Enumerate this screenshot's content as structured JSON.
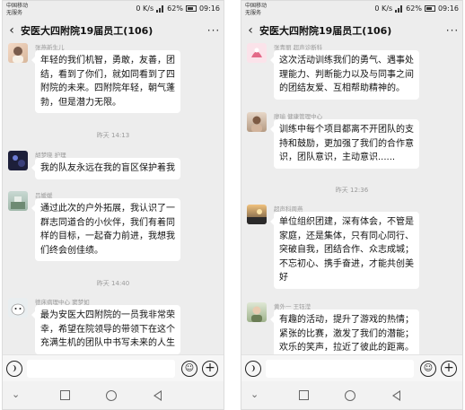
{
  "left": {
    "status": {
      "carrier_line1": "中国移动",
      "carrier_line2": "无服务",
      "speed": "0 K/s",
      "battery": "62%",
      "time": "09:16"
    },
    "header": {
      "title": "安医大四附院19届员工(106)",
      "more": "···"
    },
    "messages": [
      {
        "sender": "张燕新生儿",
        "lines": [
          "年轻的我们机智，勇敢，友善，团",
          "结，看到了你们，就如同看到了四",
          "附院的未来。四附院年轻，朝气蓬",
          "勃，但是潜力无限。"
        ]
      },
      {
        "sender": "胡梦晓 护理",
        "lines": [
          "我的队友永远在我的盲区保护着我"
        ]
      },
      {
        "sender": "吕媛媛",
        "lines": [
          "通过此次的户外拓展，我认识了一",
          "群志同道合的小伙伴，我们有着同",
          "样的目标，一起奋力前进，我想我",
          "们终会创佳绩。"
        ]
      },
      {
        "sender": "德床病理中心 窦梦如",
        "lines": [
          "最为安医大四附院的一员我非常荣",
          "幸，希望在院领导的带领下在这个",
          "充满生机的团队中书写未来的人生"
        ]
      }
    ],
    "times": [
      "昨天 14:13",
      "昨天 14:40"
    ]
  },
  "right": {
    "status": {
      "carrier_line1": "中国移动",
      "carrier_line2": "无服务",
      "speed": "0 K/s",
      "battery": "62%",
      "time": "09:16"
    },
    "header": {
      "title": "安医大四附院19届员工(106)",
      "more": "···"
    },
    "messages": [
      {
        "sender": "张青丽 超声诊断科",
        "lines": [
          "这次活动训练我们的勇气、遇事处",
          "理能力、判断能力以及与同事之间",
          "的团结友爱、互相帮助精神的。"
        ]
      },
      {
        "sender": "廖瑜 健康管理中心",
        "lines": [
          "训练中每个项目都离不开团队的支",
          "持和鼓励，更加强了我们的合作意",
          "识，团队意识，主动意识......"
        ]
      },
      {
        "sender": "超声科周燕",
        "lines": [
          "单位组织团建，深有体会，不管是",
          "家庭，还是集体，只有同心同行、",
          "突破自我，团结合作、众志成城；",
          "不忘初心、携手奋进，才能共创美",
          "好"
        ]
      },
      {
        "sender": "黄外一 王钰滢",
        "lines": [
          "有趣的活动，提升了游戏的热情；",
          "紧张的比赛，激发了我们的潜能；",
          "欢乐的笑声，拉近了彼此的距离。"
        ]
      }
    ],
    "times": [
      "昨天 12:36"
    ]
  },
  "icons": {
    "voice": "voice-icon",
    "emoji": "emoji-icon",
    "plus": "plus-icon"
  }
}
